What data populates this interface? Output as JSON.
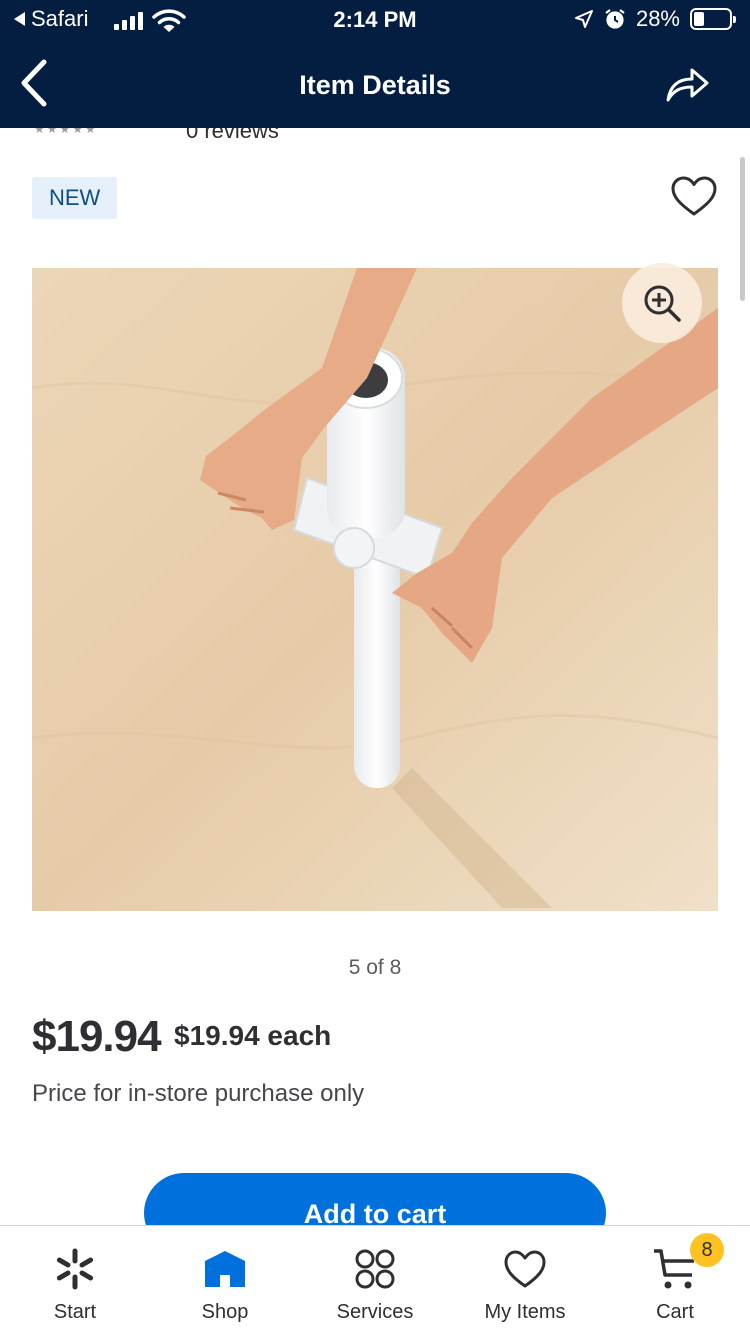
{
  "status_bar": {
    "back_app": "Safari",
    "time": "2:14 PM",
    "battery": "28%",
    "battery_level": 0.28
  },
  "nav": {
    "title": "Item Details",
    "back_icon": "chevron-left-icon",
    "share_icon": "share-arrow-icon"
  },
  "reviews_peek": {
    "link_text": "0 reviews"
  },
  "product": {
    "badge": "NEW",
    "image_counter": "5 of 8",
    "price": "$19.94",
    "unit_price": "$19.94 each",
    "price_note": "Price for in-store purchase only",
    "add_to_cart_label": "Add to cart"
  },
  "tabs": [
    {
      "label": "Start",
      "icon": "spark-icon"
    },
    {
      "label": "Shop",
      "icon": "store-icon",
      "active": true
    },
    {
      "label": "Services",
      "icon": "services-grid-icon"
    },
    {
      "label": "My Items",
      "icon": "heart-icon"
    },
    {
      "label": "Cart",
      "icon": "cart-icon"
    }
  ],
  "cart_count": "8",
  "colors": {
    "header_bg": "#041e42",
    "primary_blue": "#0071dc",
    "badge_yellow": "#ffc220",
    "new_badge_bg": "#e5f0fa",
    "new_badge_text": "#0e4e88"
  }
}
